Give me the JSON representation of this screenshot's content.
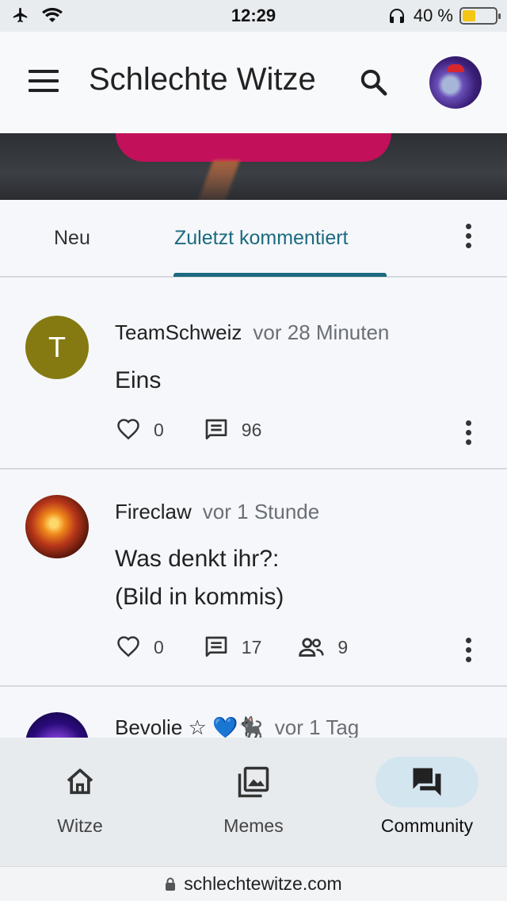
{
  "status_bar": {
    "time": "12:29",
    "battery_percent_text": "40 %",
    "battery_level": 0.4,
    "icons": [
      "airplane-icon",
      "wifi-icon",
      "headphones-icon",
      "battery-icon"
    ]
  },
  "header": {
    "title": "Schlechte Witze",
    "icons": [
      "menu-icon",
      "search-icon"
    ]
  },
  "tabs": [
    {
      "label": "Neu",
      "active": false
    },
    {
      "label": "Zuletzt kommentiert",
      "active": true
    }
  ],
  "posts": [
    {
      "author": "TeamSchweiz",
      "time": "vor 28 Minuten",
      "avatar_letter": "T",
      "content_lines": [
        "Eins"
      ],
      "likes": "0",
      "comments": "96",
      "participants": ""
    },
    {
      "author": "Fireclaw",
      "time": "vor 1 Stunde",
      "avatar_letter": "",
      "content_lines": [
        "Was denkt ihr?:",
        "(Bild in kommis)"
      ],
      "likes": "0",
      "comments": "17",
      "participants": "9"
    },
    {
      "author": "Bevolie ☆ 💙🐈‍⬛",
      "time": "vor 1 Tag",
      "avatar_letter": "",
      "content_lines": [],
      "likes": "",
      "comments": "",
      "participants": ""
    }
  ],
  "bottom_nav": [
    {
      "label": "Witze",
      "icon": "home-icon",
      "active": false
    },
    {
      "label": "Memes",
      "icon": "images-icon",
      "active": false
    },
    {
      "label": "Community",
      "icon": "forum-icon",
      "active": true
    }
  ],
  "url_bar": {
    "url": "schlechtewitze.com",
    "icon": "lock-icon"
  },
  "colors": {
    "accent": "#1d6a80",
    "banner_button": "#c2105a",
    "avatar_team": "#857a11"
  }
}
